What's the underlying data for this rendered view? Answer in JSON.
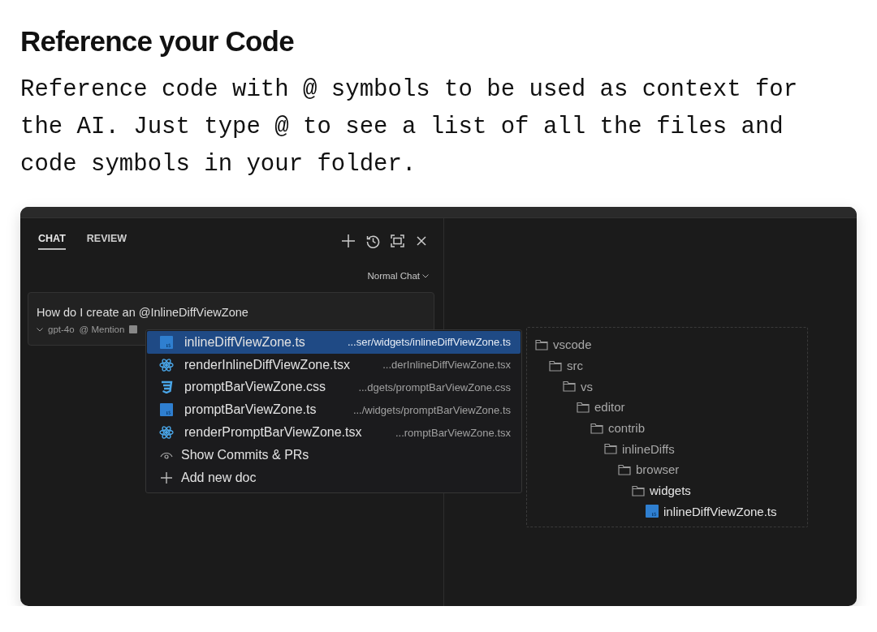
{
  "heading": "Reference your Code",
  "description": "Reference code with @ symbols to be used as context for the AI. Just type @ to see a list of all the files and code symbols in your folder.",
  "chat": {
    "tabs": [
      {
        "label": "CHAT",
        "selected": true
      },
      {
        "label": "REVIEW",
        "selected": false
      }
    ],
    "mode": "Normal Chat",
    "prompt": "How do I create an @InlineDiffViewZone",
    "model": "gpt-4o",
    "mention": "@ Mention"
  },
  "menu": [
    {
      "kind": "ts",
      "name": "inlineDiffViewZone.ts",
      "path": "...ser/widgets/inlineDiffViewZone.ts",
      "selected": true
    },
    {
      "kind": "react",
      "name": "renderInlineDiffViewZone.tsx",
      "path": "...derInlineDiffViewZone.tsx",
      "selected": false
    },
    {
      "kind": "css",
      "name": "promptBarViewZone.css",
      "path": "...dgets/promptBarViewZone.css",
      "selected": false
    },
    {
      "kind": "ts",
      "name": "promptBarViewZone.ts",
      "path": ".../widgets/promptBarViewZone.ts",
      "selected": false
    },
    {
      "kind": "react",
      "name": "renderPromptBarViewZone.tsx",
      "path": "...romptBarViewZone.tsx",
      "selected": false
    },
    {
      "kind": "commits",
      "name": "Show Commits & PRs",
      "selected": false
    },
    {
      "kind": "add",
      "name": "Add new doc",
      "selected": false
    }
  ],
  "tree": [
    {
      "kind": "folder",
      "label": "vscode",
      "children": [
        {
          "kind": "folder",
          "label": "src",
          "children": [
            {
              "kind": "folder",
              "label": "vs",
              "children": [
                {
                  "kind": "folder",
                  "label": "editor",
                  "children": [
                    {
                      "kind": "folder",
                      "label": "contrib",
                      "children": [
                        {
                          "kind": "folder",
                          "label": "inlineDiffs",
                          "children": [
                            {
                              "kind": "folder",
                              "label": "browser",
                              "children": [
                                {
                                  "kind": "folder",
                                  "label": "widgets",
                                  "children": [
                                    {
                                      "kind": "ts",
                                      "label": "inlineDiffViewZone.ts"
                                    }
                                  ]
                                }
                              ]
                            }
                          ]
                        }
                      ]
                    }
                  ]
                }
              ]
            }
          ]
        }
      ]
    }
  ]
}
